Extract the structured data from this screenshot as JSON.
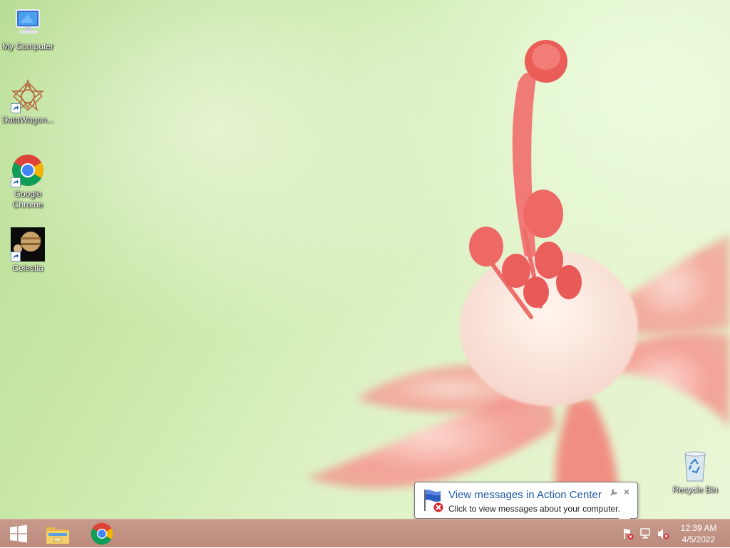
{
  "desktop": {
    "icons": [
      {
        "label": "My Computer",
        "icon": "computer-icon"
      },
      {
        "label": "DataWagon...",
        "icon": "datawagon-icon"
      },
      {
        "label": "Google Chrome",
        "icon": "chrome-icon"
      },
      {
        "label": "Celestia",
        "icon": "celestia-icon"
      },
      {
        "label": "Recycle Bin",
        "icon": "recycle-bin-icon"
      }
    ]
  },
  "notification": {
    "title": "View messages in Action Center",
    "body": "Click to view messages about your computer.",
    "close_glyph": "×",
    "icon": "action-center-flag-icon"
  },
  "taskbar": {
    "start_icon": "windows-logo-icon",
    "pinned": [
      {
        "name": "File Explorer",
        "icon": "file-explorer-icon"
      },
      {
        "name": "Google Chrome",
        "icon": "chrome-icon"
      }
    ],
    "tray": {
      "icons": [
        "action-center-icon",
        "network-icon",
        "volume-muted-icon"
      ],
      "time": "12:39 AM",
      "date": "4/5/2022"
    }
  },
  "colors": {
    "taskbar": "#c79a8c",
    "notification_title": "#1e5aa8"
  }
}
